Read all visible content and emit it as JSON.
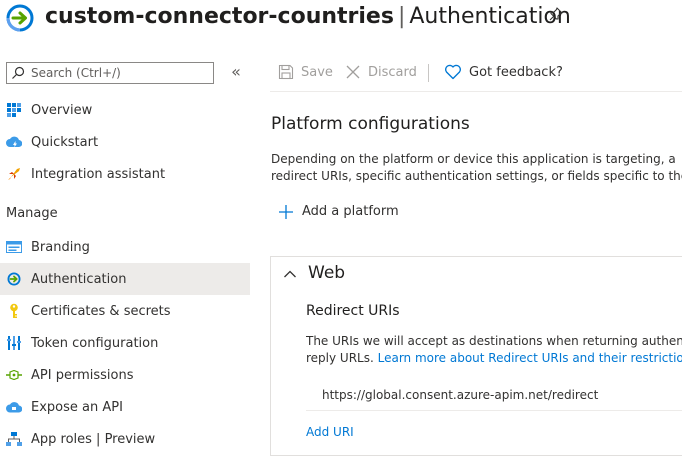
{
  "header": {
    "app_name": "custom-connector-countries",
    "separator": "|",
    "section": "Authentication"
  },
  "sidebar": {
    "search_placeholder": "Search (Ctrl+/)",
    "collapse_glyph": "«",
    "top_items": [
      {
        "label": "Overview",
        "icon": "overview-icon"
      },
      {
        "label": "Quickstart",
        "icon": "quickstart-icon"
      },
      {
        "label": "Integration assistant",
        "icon": "rocket-icon"
      }
    ],
    "manage_header": "Manage",
    "manage_items": [
      {
        "label": "Branding",
        "icon": "branding-icon"
      },
      {
        "label": "Authentication",
        "icon": "authentication-icon",
        "active": true
      },
      {
        "label": "Certificates & secrets",
        "icon": "key-icon"
      },
      {
        "label": "Token configuration",
        "icon": "token-icon"
      },
      {
        "label": "API permissions",
        "icon": "api-permissions-icon"
      },
      {
        "label": "Expose an API",
        "icon": "cloud-icon"
      },
      {
        "label": "App roles | Preview",
        "icon": "app-roles-icon"
      }
    ]
  },
  "toolbar": {
    "save_label": "Save",
    "discard_label": "Discard",
    "feedback_label": "Got feedback?"
  },
  "main": {
    "platform_title": "Platform configurations",
    "platform_desc_line1": "Depending on the platform or device this application is targeting, a",
    "platform_desc_line2": "redirect URIs, specific authentication settings, or fields specific to the pla",
    "add_platform_label": "Add a platform",
    "web": {
      "title": "Web",
      "redirect_title": "Redirect URIs",
      "redirect_desc_line1": "The URIs we will accept as destinations when returning authentica",
      "redirect_desc_line2_prefix": "reply URLs. ",
      "learn_more_link": "Learn more about Redirect URIs and their restrictions",
      "uri_value": "https://global.consent.azure-apim.net/redirect",
      "add_uri_label": "Add URI"
    }
  },
  "colors": {
    "accent": "#0078d4",
    "active_bg": "#edebe9",
    "disabled_text": "#a19f9d"
  }
}
